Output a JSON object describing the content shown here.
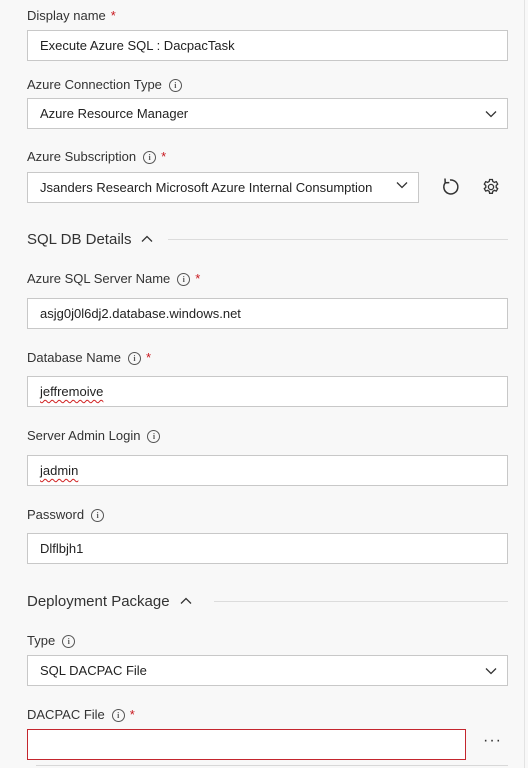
{
  "display_name": {
    "label": "Display name",
    "required": "*",
    "value": "Execute Azure SQL : DacpacTask"
  },
  "connection_type": {
    "label": "Azure Connection Type",
    "info_icon": "info-icon",
    "value": "Azure Resource Manager"
  },
  "subscription": {
    "label": "Azure Subscription",
    "required": "*",
    "value": "Jsanders Research Microsoft Azure Internal Consumption",
    "refresh_icon": "refresh-icon",
    "manage_icon": "gear-icon"
  },
  "sql_section": {
    "title": "SQL DB Details",
    "toggle_icon": "chevron-up-icon"
  },
  "server_name": {
    "label": "Azure SQL Server Name",
    "required": "*",
    "value": "asjg0j0l6dj2.database.windows.net"
  },
  "database_name": {
    "label": "Database Name",
    "required": "*",
    "value": "jeffremoive"
  },
  "admin_login": {
    "label": "Server Admin Login",
    "value": "jadmin"
  },
  "password": {
    "label": "Password",
    "value": "Dlflbjh1"
  },
  "deployment_section": {
    "title": "Deployment Package",
    "toggle_icon": "chevron-up-icon"
  },
  "type": {
    "label": "Type",
    "value": "SQL DACPAC File"
  },
  "dacpac_file": {
    "label": "DACPAC File",
    "required": "*",
    "value": "",
    "browse_label": "···"
  },
  "colors": {
    "required": "#c8161d",
    "error_border": "#c4262e",
    "spell_underline": "#d02020"
  }
}
